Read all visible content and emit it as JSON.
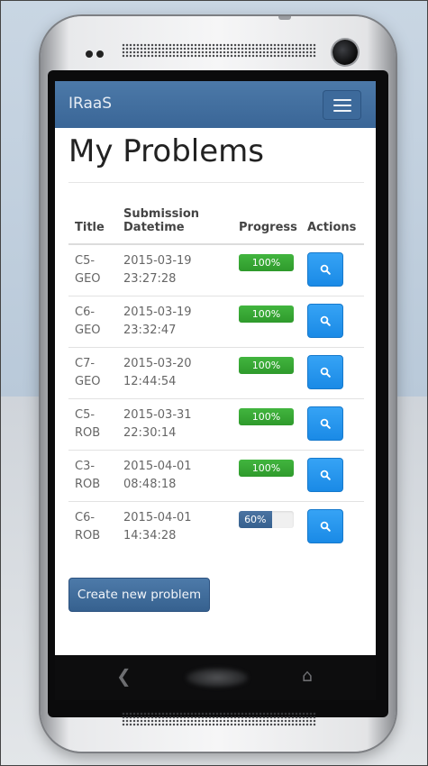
{
  "app": {
    "brand": "IRaaS",
    "page_title": "My Problems"
  },
  "table": {
    "headers": {
      "title": "Title",
      "datetime": "Submission Datetime",
      "progress": "Progress",
      "actions": "Actions"
    },
    "rows": [
      {
        "title": "C5-GEO",
        "date": "2015-03-19",
        "time": "23:27:28",
        "progress_label": "100%",
        "progress_value": 100
      },
      {
        "title": "C6-GEO",
        "date": "2015-03-19",
        "time": "23:32:47",
        "progress_label": "100%",
        "progress_value": 100
      },
      {
        "title": "C7-GEO",
        "date": "2015-03-20",
        "time": "12:44:54",
        "progress_label": "100%",
        "progress_value": 100
      },
      {
        "title": "C5-ROB",
        "date": "2015-03-31",
        "time": "22:30:14",
        "progress_label": "100%",
        "progress_value": 100
      },
      {
        "title": "C3-ROB",
        "date": "2015-04-01",
        "time": "08:48:18",
        "progress_label": "100%",
        "progress_value": 100
      },
      {
        "title": "C6-ROB",
        "date": "2015-04-01",
        "time": "14:34:28",
        "progress_label": "60%",
        "progress_value": 60
      }
    ]
  },
  "actions": {
    "create_label": "Create new problem"
  },
  "colors": {
    "navbar": "#3a6697",
    "progress_complete": "#2f9a2c",
    "progress_partial": "#36608e",
    "view_button": "#1a8ae6"
  },
  "icons": {
    "menu": "hamburger-icon",
    "view": "search-icon",
    "back": "back-icon",
    "home": "home-icon"
  }
}
